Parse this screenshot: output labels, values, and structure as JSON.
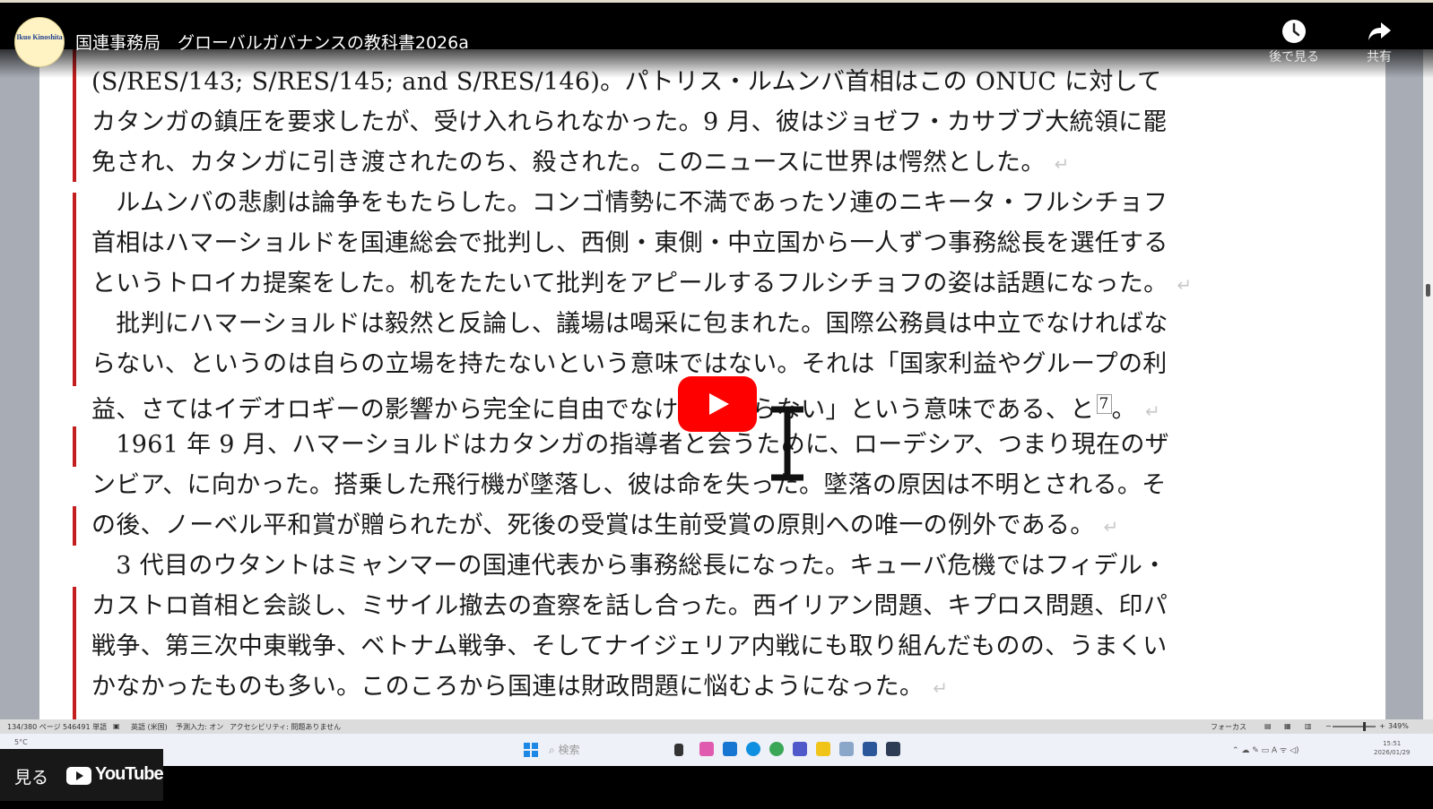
{
  "header": {
    "channel_avatar_text": "Ikuo Kinoshita",
    "video_title": "国連事務局　グローバルガバナンスの教科書2026a",
    "watch_later_label": "後で見る",
    "share_label": "共有"
  },
  "document": {
    "lines": [
      "(S/RES/143; S/RES/145; and S/RES/146)。パトリス・ルムンバ首相はこの ONUC に対して",
      "カタンガの鎮圧を要求したが、受け入れられなかった。9 月、彼はジョゼフ・カサブブ大統領に罷",
      "免され、カタンガに引き渡されたのち、殺された。このニュースに世界は愕然とした。",
      "　ルムンバの悲劇は論争をもたらした。コンゴ情勢に不満であったソ連のニキータ・フルシチョフ",
      "首相はハマーショルドを国連総会で批判し、西側・東側・中立国から一人ずつ事務総長を選任する",
      "というトロイカ提案をした。机をたたいて批判をアピールするフルシチョフの姿は話題になった。",
      "　批判にハマーショルドは毅然と反論し、議場は喝采に包まれた。国際公務員は中立でなければな",
      "らない、というのは自らの立場を持たないという意味ではない。それは「国家利益やグループの利",
      "益、さてはイデオロギーの影響から完全に自由でなければならない」という意味である、と",
      "　1961 年 9 月、ハマーショルドはカタンガの指導者と会うために、ローデシア、つまり現在のザ",
      "ンビア、に向かった。搭乗した飛行機が墜落し、彼は命を失った。墜落の原因は不明とされる。そ",
      "の後、ノーベル平和賞が贈られたが、死後の受賞は生前受賞の原則への唯一の例外である。",
      "　3 代目のウタントはミャンマーの国連代表から事務総長になった。キューバ危機ではフィデル・",
      "カストロ首相と会談し、ミサイル撤去の査察を話し合った。西イリアン問題、キプロス問題、印パ",
      "戦争、第三次中東戦争、ベトナム戦争、そしてナイジェリア内戦にも取り組んだものの、うまくい",
      "かなかったものも多い。このころから国連は財政問題に悩むようになった。"
    ],
    "footnote_ref": "7",
    "footnote_tail": "。",
    "paragraph_mark": "↵"
  },
  "statusbar": {
    "page": "134/380 ページ",
    "words": "546491 単語",
    "language": "英語 (米国)",
    "predict": "予測入力: オン",
    "accessibility": "アクセシビリティ: 問題ありません",
    "focus": "フォーカス",
    "zoom": "349%"
  },
  "taskbar": {
    "search_placeholder": "検索",
    "weather": "5°C",
    "time": "15:51",
    "date": "2026/01/29"
  },
  "overlay": {
    "watch_on": "見る",
    "youtube": "YouTube"
  }
}
